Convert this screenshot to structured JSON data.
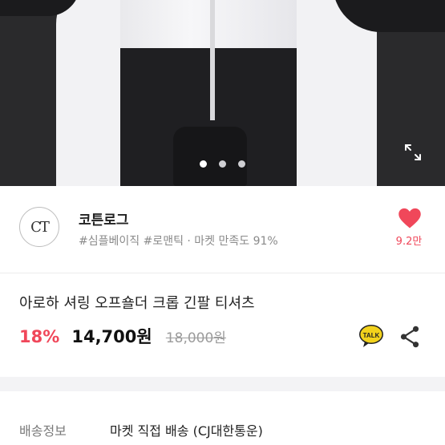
{
  "hero": {
    "image_description_icon": "product-photo",
    "carousel": {
      "count": 3,
      "active_index": 0
    },
    "expand_icon": "expand-icon"
  },
  "shop": {
    "logo_text": "CT",
    "name": "코튼로그",
    "tags": "#심플베이직 #로맨틱 · 마켓 만족도 91%",
    "likes": "9.2만",
    "accent_color": "#f0475a"
  },
  "product": {
    "title": "아로하 셔링 오프숄더 크롭 긴팔 티셔츠",
    "discount": "18%",
    "price": "14,700원",
    "original_price": "18,000원",
    "talk_label": "TALK"
  },
  "shipping": {
    "label": "배송정보",
    "value": "마켓 직접 배송 (CJ대한통운)"
  }
}
